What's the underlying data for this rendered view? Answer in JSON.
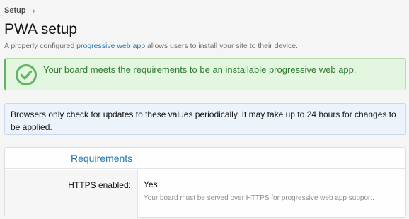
{
  "breadcrumb": {
    "item": "Setup"
  },
  "page": {
    "title": "PWA setup",
    "desc_before": "A properly configured ",
    "desc_link": "progressive web app",
    "desc_after": " allows users to install your site to their device."
  },
  "success": {
    "message": "Your board meets the requirements to be an installable progressive web app.",
    "icon": "check-circle-icon",
    "color": "#63b265"
  },
  "info": {
    "message": "Browsers only check for updates to these values periodically. It may take up to 24 hours for changes to be applied."
  },
  "requirements": {
    "title": "Requirements",
    "rows": [
      {
        "label": "HTTPS enabled:",
        "value": "Yes",
        "explain": "Your board must be served over HTTPS for progressive web app support."
      }
    ]
  },
  "colors": {
    "link": "#2577b1",
    "success_bg": "#e3f6e0",
    "info_bg": "#ecf3fb"
  }
}
